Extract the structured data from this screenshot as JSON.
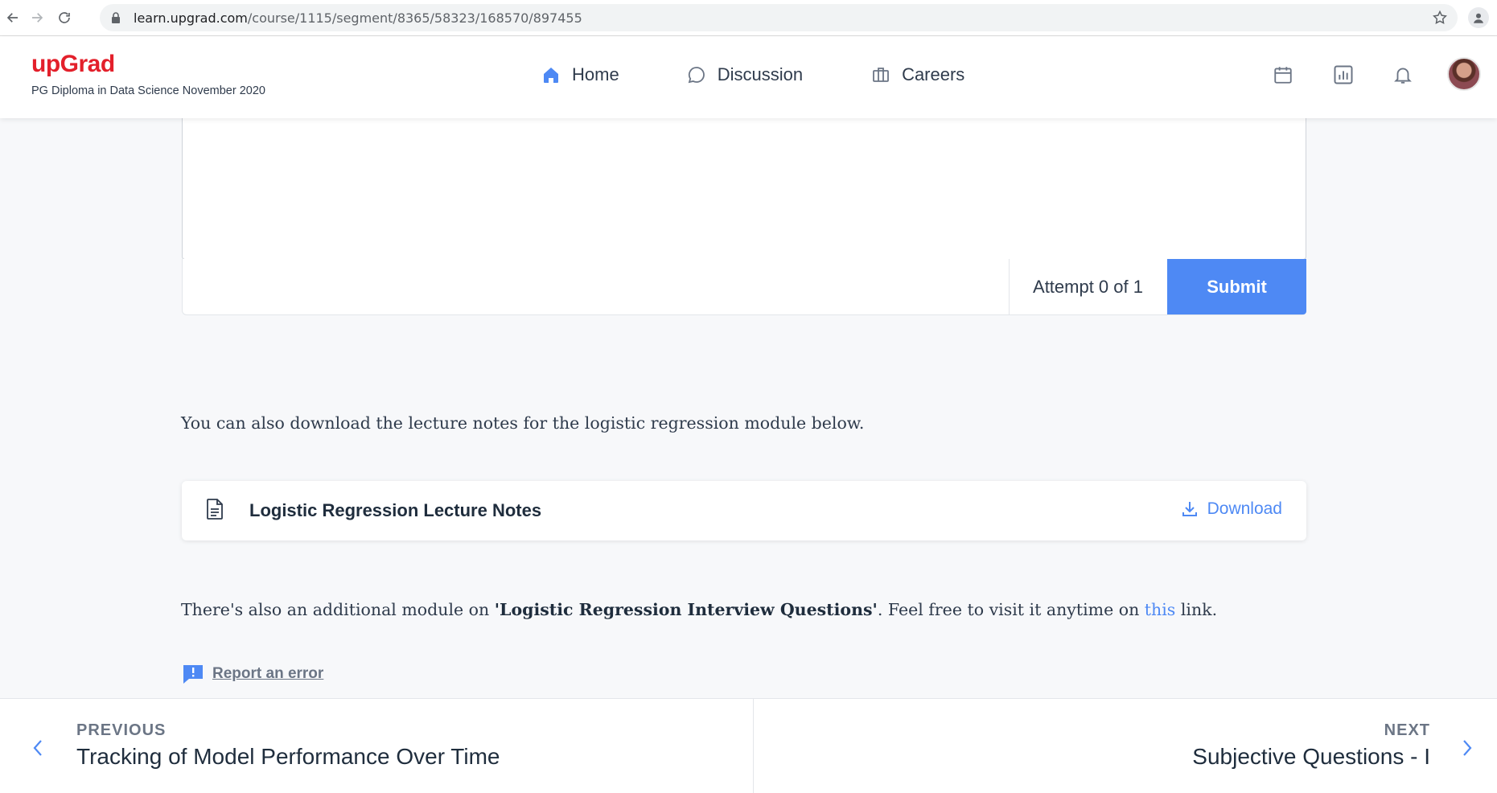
{
  "browser": {
    "url_domain": "learn.upgrad.com",
    "url_path": "/course/1115/segment/8365/58323/168570/897455"
  },
  "header": {
    "logo": "upGrad",
    "program": "PG Diploma in Data Science November 2020",
    "nav": {
      "home": "Home",
      "discussion": "Discussion",
      "careers": "Careers"
    },
    "accent_color": "#4e89f4",
    "brand_color": "#e3202b"
  },
  "question": {
    "attempt_text": "Attempt 0 of 1",
    "submit_label": "Submit"
  },
  "content": {
    "notes_intro": "You can also download the lecture notes for the logistic regression module below.",
    "download_card": {
      "title": "Logistic Regression Lecture Notes",
      "action_label": "Download"
    },
    "additional": {
      "prefix": "There's also an additional module on ",
      "module_name": "'Logistic Regression Interview Questions'",
      "middle": ". Feel free to visit it anytime on ",
      "link_text": "this",
      "suffix": " link."
    },
    "report_label": "Report an error"
  },
  "bottom_nav": {
    "previous_kicker": "PREVIOUS",
    "previous_title": "Tracking of Model Performance Over Time",
    "next_kicker": "NEXT",
    "next_title": "Subjective Questions - I"
  }
}
